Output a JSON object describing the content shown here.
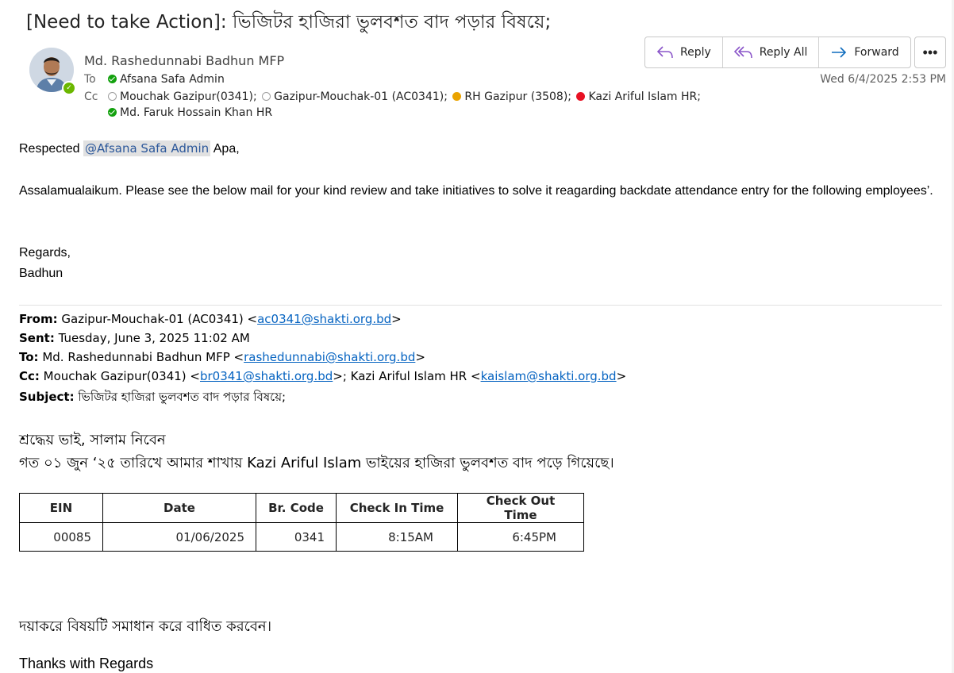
{
  "email": {
    "subject": "[Need to take Action]: ভিজিটর হাজিরা ভুলবশত বাদ পড়ার বিষয়ে;",
    "sender": "Md. Rashedunnabi Badhun MFP",
    "to_label": "To",
    "to": "Afsana Safa Admin",
    "cc_label": "Cc",
    "cc": [
      {
        "name": "Mouchak Gazipur(0341);",
        "status": "empty"
      },
      {
        "name": "Gazipur-Mouchak-01 (AC0341);",
        "status": "empty"
      },
      {
        "name": "RH Gazipur (3508);",
        "status": "yellow"
      },
      {
        "name": "Kazi Ariful Islam HR;",
        "status": "red"
      }
    ],
    "cc_line2": "Md. Faruk Hossain Khan HR",
    "date": "Wed 6/4/2025 2:53 PM"
  },
  "actions": {
    "reply": "Reply",
    "reply_all": "Reply All",
    "forward": "Forward",
    "more": "•••"
  },
  "body": {
    "greeting_prefix": "Respected ",
    "mention": "@Afsana Safa Admin",
    "greeting_suffix": " Apa,",
    "paragraph": "Assalamualaikum. Please see the below mail for your kind review and take initiatives to solve it reagarding backdate attendance entry for the following employees’.",
    "regards": "Regards,",
    "name": "Badhun"
  },
  "forwarded": {
    "from_label": "From:",
    "from_name": " Gazipur-Mouchak-01 (AC0341) <",
    "from_email": "ac0341@shakti.org.bd",
    "sent_label": "Sent:",
    "sent": " Tuesday, June 3, 2025 11:02 AM",
    "to_label": "To:",
    "to_name": " Md. Rashedunnabi Badhun MFP <",
    "to_email": "rashedunnabi@shakti.org.bd",
    "cc_label": "Cc:",
    "cc_name1": " Mouchak Gazipur(0341) <",
    "cc_email1": "br0341@shakti.org.bd",
    "cc_mid": ">; Kazi Ariful Islam HR <",
    "cc_email2": "kaislam@shakti.org.bd",
    "subject_label": "Subject:",
    "subject": " ভিজিটর হাজিরা ভুলবশত বাদ পড়ার বিষয়ে;",
    "line1": "শ্রদ্ধেয় ভাই, সালাম নিবেন",
    "line2": "গত ০১ জুন ‘২৫ তারিখে আমার শাখায় Kazi Ariful Islam ভাইয়ের হাজিরা ভুলবশত বাদ পড়ে গিয়েছে।",
    "table": {
      "headers": [
        "EIN",
        "Date",
        "Br. Code",
        "Check In Time",
        "Check Out Time"
      ],
      "row": [
        "00085",
        "01/06/2025",
        "0341",
        "8:15AM",
        "6:45PM"
      ]
    },
    "closing": "দয়াকরে বিষয়টি সমাধান করে বাধিত করবেন।",
    "thanks": "Thanks with Regards"
  }
}
